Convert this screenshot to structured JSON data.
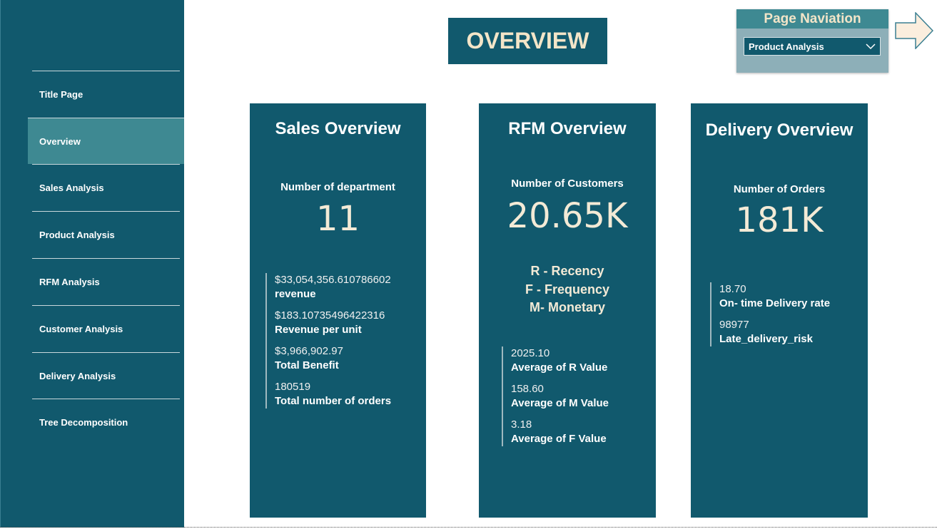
{
  "sidebar": {
    "items": [
      {
        "label": "Title Page"
      },
      {
        "label": "Overview",
        "active": true
      },
      {
        "label": "Sales Analysis"
      },
      {
        "label": "Product Analysis"
      },
      {
        "label": "RFM Analysis"
      },
      {
        "label": "Customer Analysis"
      },
      {
        "label": "Delivery Analysis"
      },
      {
        "label": "Tree Decomposition"
      }
    ]
  },
  "header": {
    "title": "OVERVIEW"
  },
  "page_nav": {
    "title": "Page Naviation",
    "selected": "Product Analysis",
    "chevron_icon": "chevron-down-icon",
    "arrow_icon": "right-arrow-icon"
  },
  "colors": {
    "primary": "#11596d",
    "accent": "#3e8992",
    "cream": "#f3e5c8",
    "nav_panel": "#8dafb8"
  },
  "cards": {
    "sales": {
      "title": "Sales Overview",
      "metric_label": "Number of department",
      "metric_value": "11",
      "kpis": [
        {
          "value": "$33,054,356.610786602",
          "label": "revenue"
        },
        {
          "value": "$183.10735496422316",
          "label": "Revenue per unit"
        },
        {
          "value": "$3,966,902.97",
          "label": "Total Benefit"
        },
        {
          "value": "180519",
          "label": "Total number of orders"
        }
      ]
    },
    "rfm": {
      "title": "RFM Overview",
      "metric_label": "Number of Customers",
      "metric_value": "20.65K",
      "legend": [
        "R - Recency",
        "F - Frequency",
        "M- Monetary"
      ],
      "kpis": [
        {
          "value": "2025.10",
          "label": "Average of R Value"
        },
        {
          "value": "158.60",
          "label": "Average of M Value"
        },
        {
          "value": "3.18",
          "label": "Average of F Value"
        }
      ]
    },
    "delivery": {
      "title": "Delivery Overview",
      "metric_label": "Number of Orders",
      "metric_value": "181K",
      "kpis": [
        {
          "value": "18.70",
          "label": "On- time Delivery rate"
        },
        {
          "value": "98977",
          "label": "Late_delivery_risk"
        }
      ]
    }
  }
}
